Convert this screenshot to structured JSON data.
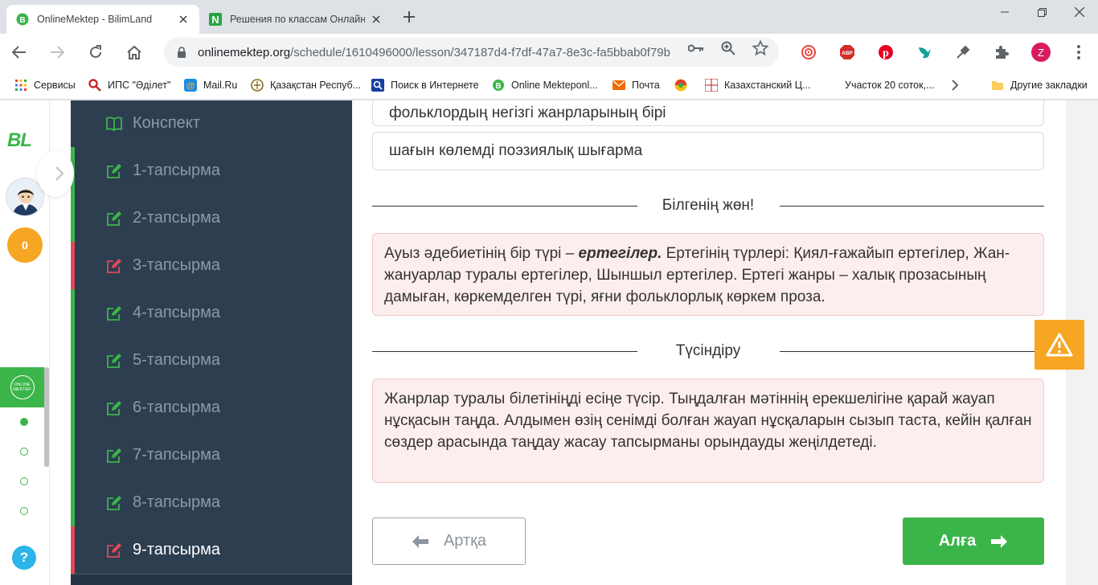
{
  "browser": {
    "tabs": [
      {
        "title": "OnlineMektep - BilimLand",
        "active": true,
        "favicon_color": "#3bb54a"
      },
      {
        "title": "Решения по классам Онлайн",
        "active": false,
        "favicon_color": "#2aa345"
      }
    ],
    "address": {
      "host": "onlinemektep.org",
      "path": "/schedule/1610496000/lesson/347187d4-f7df-47a7-8e3c-fa5bbab0f79b"
    },
    "profile_initial": "Z",
    "bookmarks": [
      {
        "label": "Сервисы"
      },
      {
        "label": "ИПС \"Әділет\""
      },
      {
        "label": "Mail.Ru"
      },
      {
        "label": "Қазақстан Респуб..."
      },
      {
        "label": "Поиск в Интернете"
      },
      {
        "label": "Online Mekteponl..."
      },
      {
        "label": "Почта"
      },
      {
        "label": "Казахстанский Ц..."
      },
      {
        "label": "Участок 20 соток,..."
      },
      {
        "label": "Другие закладки"
      }
    ]
  },
  "rail": {
    "logo": "BL",
    "coins": "0",
    "help": "?",
    "om_logo": "ONLINE MEKTEP"
  },
  "sidebar": {
    "items": [
      {
        "label": "Конспект",
        "status": "none"
      },
      {
        "label": "1-тапсырма",
        "status": "green"
      },
      {
        "label": "2-тапсырма",
        "status": "green"
      },
      {
        "label": "3-тапсырма",
        "status": "red"
      },
      {
        "label": "4-тапсырма",
        "status": "green"
      },
      {
        "label": "5-тапсырма",
        "status": "green"
      },
      {
        "label": "6-тапсырма",
        "status": "green"
      },
      {
        "label": "7-тапсырма",
        "status": "green"
      },
      {
        "label": "8-тапсырма",
        "status": "green"
      },
      {
        "label": "9-тапсырма",
        "status": "red"
      }
    ]
  },
  "main": {
    "options": [
      "фольклордың негізгі жанрларының бірі",
      "шағын көлемді поэзиялық шығарма"
    ],
    "know_title": "Білгенің жөн!",
    "know_text_before": "Ауыз әдебиетінің бір түрі – ",
    "know_text_bold": "ертегілер.",
    "know_text_after": " Ертегінің түрлері: Қиял-ғажайып ертегілер, Жан-жануарлар туралы ертегілер, Шыншыл ертегілер. Ертегі жанры – халық прозасының дамыған, көркемделген түрі, яғни фольклорлық көркем проза.",
    "explain_title": "Түсіндіру",
    "explain_text": "Жанрлар туралы білетініңді есіңе түсір. Тыңдалған мәтіннің ерекшелігіне қарай жауап нұсқасын таңда. Алдымен өзің сенімді болған жауап нұсқаларын сызып таста, кейін қалған сөздер арасында таңдау жасау тапсырманы орындауды жеңілдетеді.",
    "back_label": "Артқа",
    "next_label": "Алға"
  },
  "colors": {
    "green": "#3bb54a",
    "red": "#e04a5a",
    "sidebar_bg": "#2d3e50",
    "warning": "#f6a623",
    "info_bg": "#fdeeee"
  }
}
